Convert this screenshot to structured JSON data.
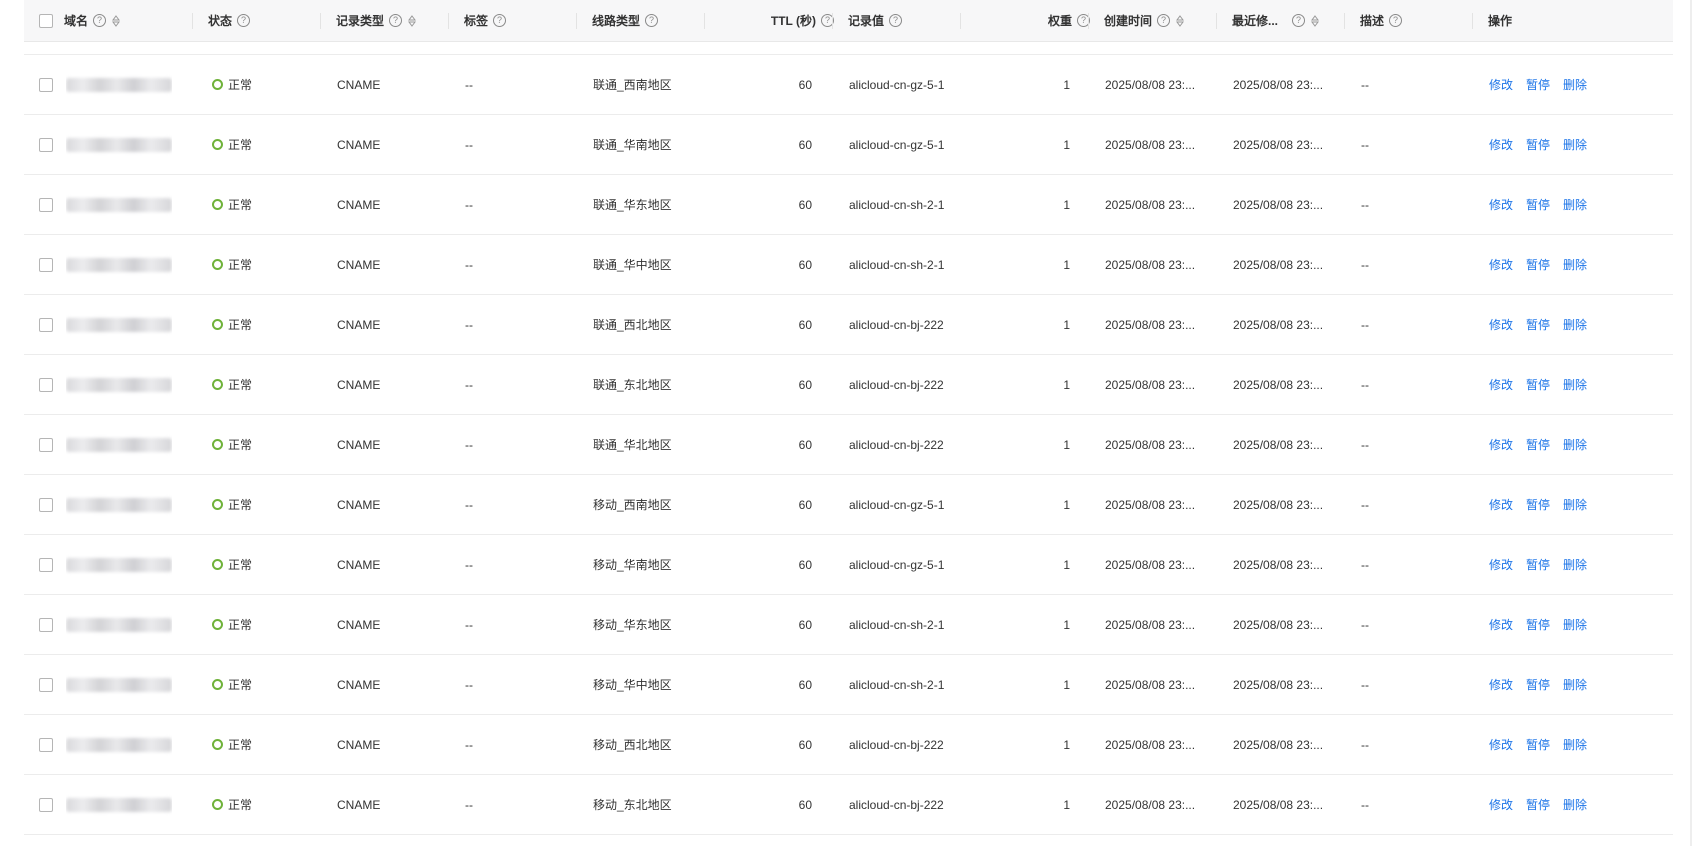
{
  "header": {
    "domain": "域名",
    "status": "状态",
    "record_type": "记录类型",
    "tag": "标签",
    "line_type": "线路类型",
    "ttl": "TTL (秒)",
    "record_value": "记录值",
    "weight": "权重",
    "created": "创建时间",
    "modified": "最近修...",
    "description": "描述",
    "actions": "操作"
  },
  "actions": {
    "modify": "修改",
    "pause": "暂停",
    "delete": "删除"
  },
  "rows": [
    {
      "status": "正常",
      "type": "CNAME",
      "tag": "--",
      "line": "联通_西南地区",
      "ttl": "60",
      "value": "alicloud-cn-gz-5-1",
      "weight": "1",
      "created": "2025/08/08 23:...",
      "modified": "2025/08/08 23:...",
      "desc": "--"
    },
    {
      "status": "正常",
      "type": "CNAME",
      "tag": "--",
      "line": "联通_华南地区",
      "ttl": "60",
      "value": "alicloud-cn-gz-5-1",
      "weight": "1",
      "created": "2025/08/08 23:...",
      "modified": "2025/08/08 23:...",
      "desc": "--"
    },
    {
      "status": "正常",
      "type": "CNAME",
      "tag": "--",
      "line": "联通_华东地区",
      "ttl": "60",
      "value": "alicloud-cn-sh-2-1",
      "weight": "1",
      "created": "2025/08/08 23:...",
      "modified": "2025/08/08 23:...",
      "desc": "--"
    },
    {
      "status": "正常",
      "type": "CNAME",
      "tag": "--",
      "line": "联通_华中地区",
      "ttl": "60",
      "value": "alicloud-cn-sh-2-1",
      "weight": "1",
      "created": "2025/08/08 23:...",
      "modified": "2025/08/08 23:...",
      "desc": "--"
    },
    {
      "status": "正常",
      "type": "CNAME",
      "tag": "--",
      "line": "联通_西北地区",
      "ttl": "60",
      "value": "alicloud-cn-bj-222",
      "weight": "1",
      "created": "2025/08/08 23:...",
      "modified": "2025/08/08 23:...",
      "desc": "--"
    },
    {
      "status": "正常",
      "type": "CNAME",
      "tag": "--",
      "line": "联通_东北地区",
      "ttl": "60",
      "value": "alicloud-cn-bj-222",
      "weight": "1",
      "created": "2025/08/08 23:...",
      "modified": "2025/08/08 23:...",
      "desc": "--"
    },
    {
      "status": "正常",
      "type": "CNAME",
      "tag": "--",
      "line": "联通_华北地区",
      "ttl": "60",
      "value": "alicloud-cn-bj-222",
      "weight": "1",
      "created": "2025/08/08 23:...",
      "modified": "2025/08/08 23:...",
      "desc": "--"
    },
    {
      "status": "正常",
      "type": "CNAME",
      "tag": "--",
      "line": "移动_西南地区",
      "ttl": "60",
      "value": "alicloud-cn-gz-5-1",
      "weight": "1",
      "created": "2025/08/08 23:...",
      "modified": "2025/08/08 23:...",
      "desc": "--"
    },
    {
      "status": "正常",
      "type": "CNAME",
      "tag": "--",
      "line": "移动_华南地区",
      "ttl": "60",
      "value": "alicloud-cn-gz-5-1",
      "weight": "1",
      "created": "2025/08/08 23:...",
      "modified": "2025/08/08 23:...",
      "desc": "--"
    },
    {
      "status": "正常",
      "type": "CNAME",
      "tag": "--",
      "line": "移动_华东地区",
      "ttl": "60",
      "value": "alicloud-cn-sh-2-1",
      "weight": "1",
      "created": "2025/08/08 23:...",
      "modified": "2025/08/08 23:...",
      "desc": "--"
    },
    {
      "status": "正常",
      "type": "CNAME",
      "tag": "--",
      "line": "移动_华中地区",
      "ttl": "60",
      "value": "alicloud-cn-sh-2-1",
      "weight": "1",
      "created": "2025/08/08 23:...",
      "modified": "2025/08/08 23:...",
      "desc": "--"
    },
    {
      "status": "正常",
      "type": "CNAME",
      "tag": "--",
      "line": "移动_西北地区",
      "ttl": "60",
      "value": "alicloud-cn-bj-222",
      "weight": "1",
      "created": "2025/08/08 23:...",
      "modified": "2025/08/08 23:...",
      "desc": "--"
    },
    {
      "status": "正常",
      "type": "CNAME",
      "tag": "--",
      "line": "移动_东北地区",
      "ttl": "60",
      "value": "alicloud-cn-bj-222",
      "weight": "1",
      "created": "2025/08/08 23:...",
      "modified": "2025/08/08 23:...",
      "desc": "--"
    }
  ],
  "colors": {
    "status_ok": "#6fb23a",
    "link": "#1a73e8",
    "header_bg": "#f7f7f8"
  },
  "icons": {
    "help": "question-circle-icon",
    "sort": "sort-icon",
    "status": "status-ring-icon"
  }
}
